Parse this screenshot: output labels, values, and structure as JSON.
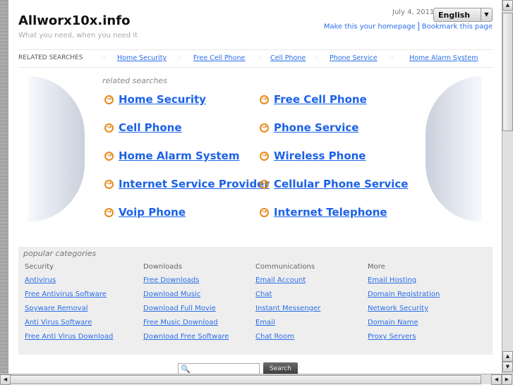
{
  "header": {
    "title": "Allworx10x.info",
    "tagline": "What you need, when you need it",
    "date": "July 4, 2011",
    "language": "English",
    "make_homepage": "Make this your homepage",
    "bookmark": "Bookmark this page"
  },
  "topbar": {
    "label": "RELATED SEARCHES",
    "separator": "::",
    "items": [
      "Home Security",
      "Free Cell Phone",
      "Cell Phone",
      "Phone Service",
      "Home Alarm System"
    ]
  },
  "related": {
    "heading": "related searches",
    "left": [
      "Home Security",
      "Cell Phone",
      "Home Alarm System",
      "Internet Service Provider",
      "Voip Phone"
    ],
    "right": [
      "Free Cell Phone",
      "Phone Service",
      "Wireless Phone",
      "Cellular Phone Service",
      "Internet Telephone"
    ]
  },
  "popular": {
    "heading": "popular categories",
    "columns": [
      {
        "title": "Security",
        "links": [
          "Antivirus",
          "Free Antivirus Software",
          "Spyware Removal",
          "Anti Virus Software",
          "Free Anti Virus Download"
        ]
      },
      {
        "title": "Downloads",
        "links": [
          "Free Downloads",
          "Download Music",
          "Download Full Movie",
          "Free Music Download",
          "Download Free Software"
        ]
      },
      {
        "title": "Communications",
        "links": [
          "Email Account",
          "Chat",
          "Instant Messenger",
          "Email",
          "Chat Room"
        ]
      },
      {
        "title": "More",
        "links": [
          "Email Hosting",
          "Domain Registration",
          "Network Security",
          "Domain Name",
          "Proxy Servers"
        ]
      }
    ]
  },
  "search": {
    "button": "Search",
    "value": ""
  },
  "colors": {
    "link": "#1c62e8",
    "arrow": "#e8891c",
    "panel": "#eeeeee"
  }
}
